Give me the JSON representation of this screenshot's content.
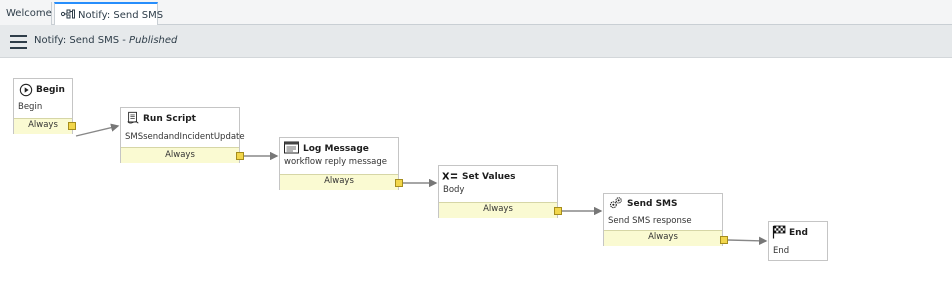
{
  "tabs": [
    {
      "label": "Welcome"
    },
    {
      "label": "Notify: Send SMS"
    }
  ],
  "header": {
    "title": "Notify: Send SMS - ",
    "status": "Published"
  },
  "nodes": {
    "begin": {
      "title": "Begin",
      "text": "Begin",
      "condition": "Always",
      "icon": "play-circle-icon"
    },
    "run_script": {
      "title": "Run Script",
      "text": "SMSsendandIncidentUpdate",
      "condition": "Always",
      "icon": "script-icon"
    },
    "log_message": {
      "title": "Log Message",
      "text": "workflow reply message",
      "condition": "Always",
      "icon": "log-icon"
    },
    "set_values": {
      "title": "Set Values",
      "text": "Body",
      "condition": "Always",
      "icon": "set-values-icon"
    },
    "send_sms": {
      "title": "Send SMS",
      "text": "Send SMS response",
      "condition": "Always",
      "icon": "gears-icon"
    },
    "end": {
      "title": "End",
      "text": "End",
      "icon": "checkered-flag-icon"
    }
  },
  "colors": {
    "active_tab_accent": "#278efc",
    "condition_fill": "#fafad2",
    "handle_fill": "#f2d64b"
  }
}
